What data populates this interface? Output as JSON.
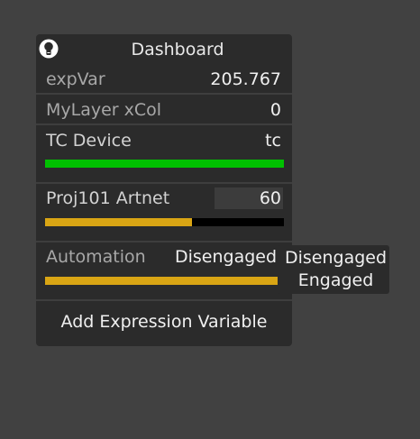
{
  "panel": {
    "title": "Dashboard",
    "icon": "lightbulb-icon"
  },
  "rows": {
    "expvar": {
      "label": "expVar",
      "value": "205.767"
    },
    "mylayer": {
      "label": "MyLayer xCol",
      "value": "0"
    },
    "tcdevice": {
      "label": "TC Device",
      "value": "tc",
      "bar_fraction": 1.0,
      "bar_color": "#00c000"
    },
    "proj": {
      "label": "Proj101 Artnet",
      "value": "60",
      "bar_fraction": 0.615,
      "bar_color": "#d9a514"
    },
    "automation": {
      "label": "Automation",
      "value": "Disengaged",
      "bar_fraction": 1.0,
      "bar_color": "#d9a514"
    }
  },
  "dropdown": {
    "options": [
      "Disengaged",
      "Engaged"
    ]
  },
  "add_button": {
    "label": "Add Expression Variable"
  },
  "colors": {
    "background": "#414141",
    "panel": "#2b2b2b",
    "green_bar": "#00c000",
    "amber_bar": "#d9a514"
  }
}
